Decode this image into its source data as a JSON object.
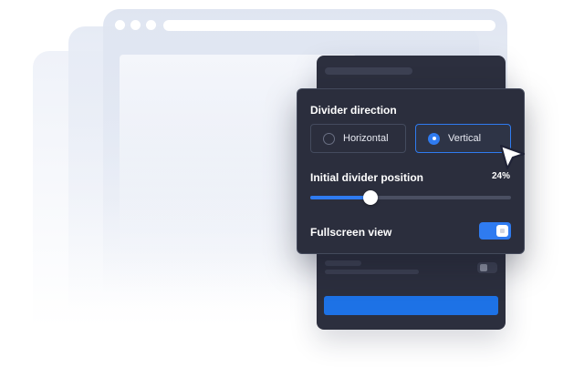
{
  "settings": {
    "direction_title": "Divider direction",
    "direction_options": [
      {
        "label": "Horizontal",
        "selected": false
      },
      {
        "label": "Vertical",
        "selected": true
      }
    ],
    "position_label": "Initial divider position",
    "position_value": "24%",
    "position_fraction": 0.3,
    "fullscreen_label": "Fullscreen view",
    "fullscreen_on": true
  },
  "colors": {
    "accent": "#2f7bf0",
    "panel_bg": "#2b2e3d",
    "primary_button": "#1d72e6"
  },
  "icons": {
    "cursor": "pointer-arrow-icon"
  }
}
